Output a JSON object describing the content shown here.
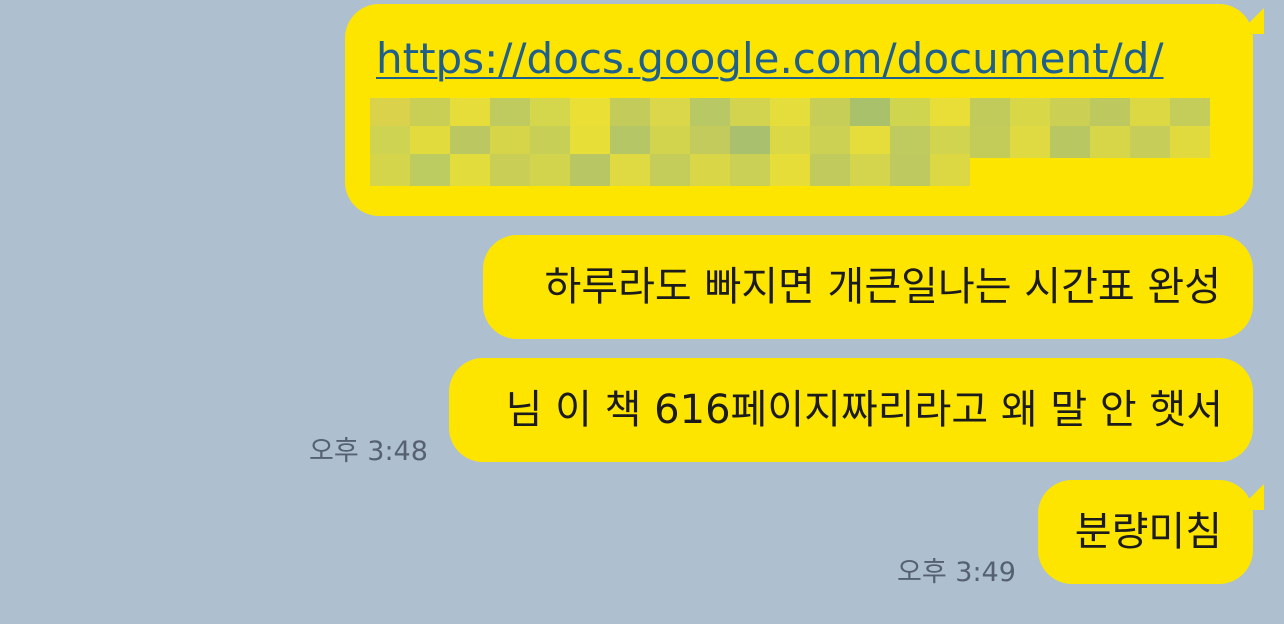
{
  "theme": {
    "background": "#aebfcf",
    "bubble_color": "#fee500",
    "text_color": "#1b1b1b",
    "link_color": "#1f5f8c",
    "timestamp_color": "#556170"
  },
  "messages": [
    {
      "text": "https://docs.google.com/document/d/",
      "is_link": true,
      "redacted": true,
      "time": ""
    },
    {
      "text": "하루라도 빠지면 개큰일나는 시간표 완성",
      "time": ""
    },
    {
      "text": "님 이 책 616페이지짜리라고 왜 말 안 햇서",
      "time": "오후 3:48"
    },
    {
      "text": "분량미침",
      "time": "오후 3:49"
    }
  ]
}
